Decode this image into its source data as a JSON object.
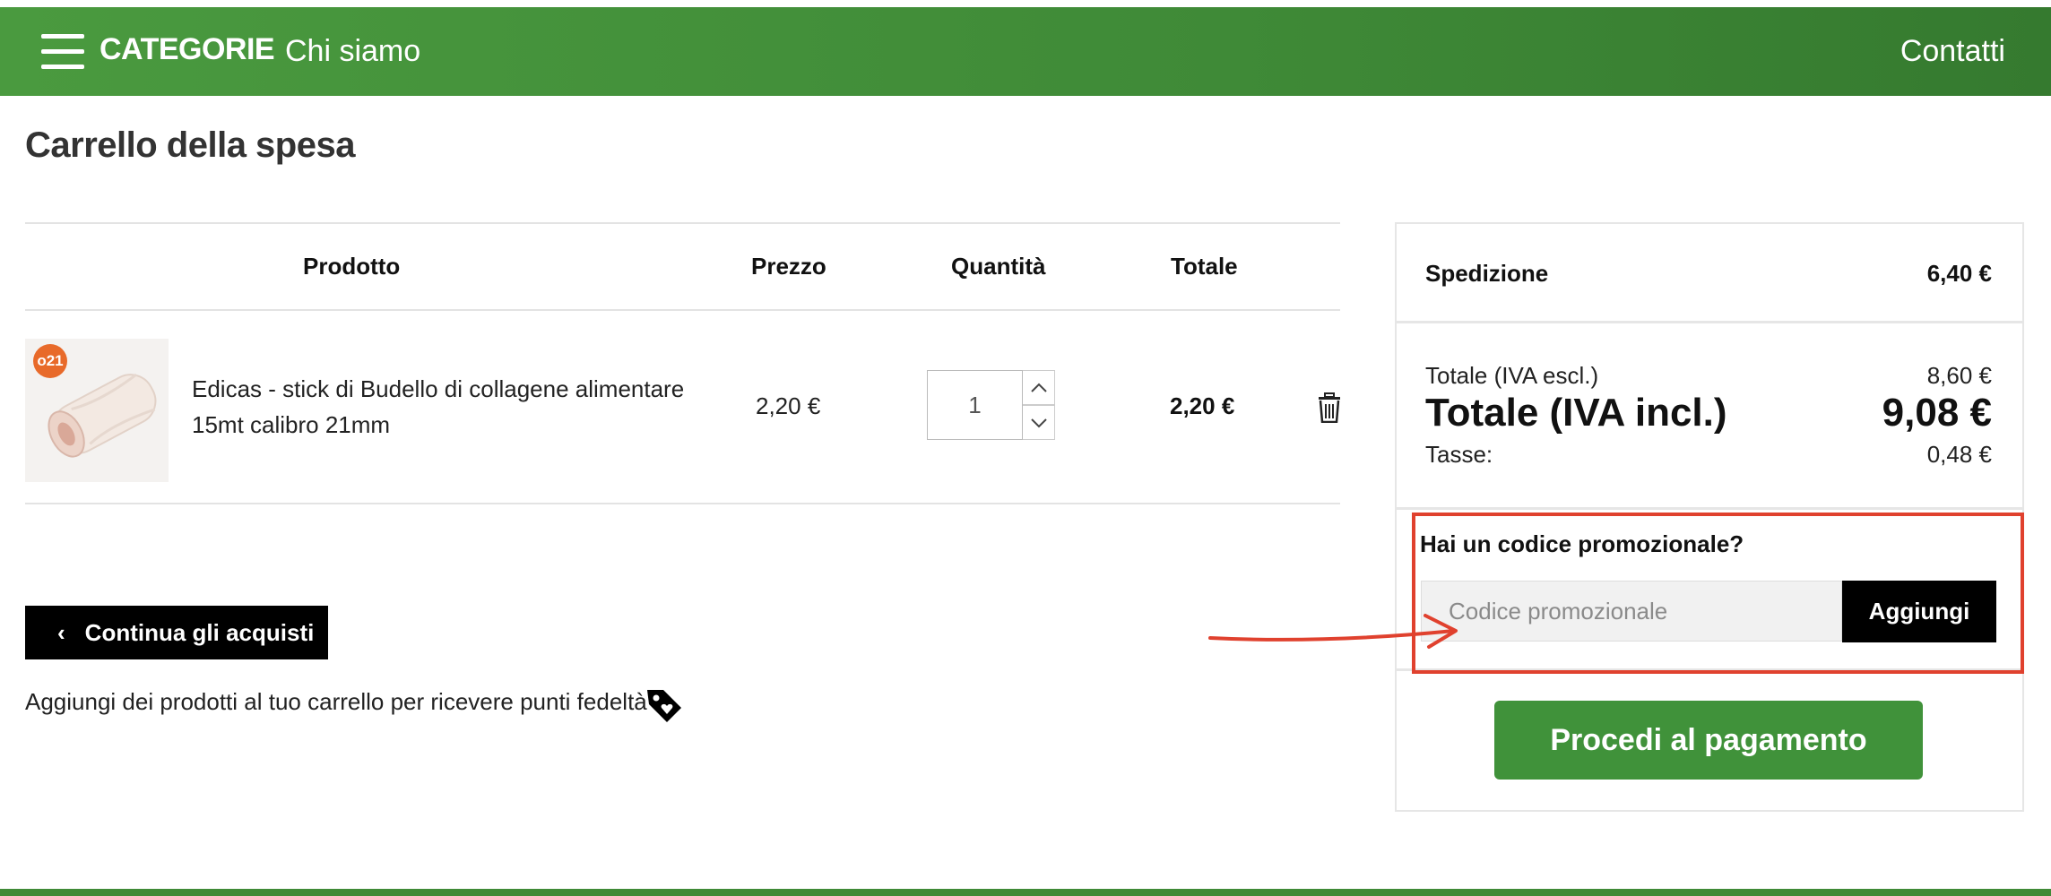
{
  "nav": {
    "menu_label": "CATEGORIE",
    "about_label": "Chi siamo",
    "contact_label": "Contatti",
    "bg_color": "#3f8a37"
  },
  "page": {
    "title": "Carrello della spesa"
  },
  "cart": {
    "columns": {
      "product": "Prodotto",
      "price": "Prezzo",
      "quantity": "Quantità",
      "total": "Totale"
    },
    "items": [
      {
        "badge": "o21",
        "name": "Edicas - stick di Budello di collagene alimentare 15mt calibro 21mm",
        "price": "2,20 €",
        "quantity": "1",
        "total": "2,20 €"
      }
    ],
    "continue_label": "Continua gli acquisti",
    "loyalty_text": "Aggiungi dei prodotti al tuo carrello per ricevere punti fedeltà ."
  },
  "summary": {
    "shipping_label": "Spedizione",
    "shipping_value": "6,40 €",
    "total_excl_label": "Totale (IVA escl.)",
    "total_excl_value": "8,60 €",
    "total_incl_label": "Totale (IVA incl.)",
    "total_incl_value": "9,08 €",
    "tax_label": "Tasse:",
    "tax_value": "0,48 €",
    "promo_title": "Hai un codice promozionale?",
    "promo_placeholder": "Codice promozionale",
    "promo_button": "Aggiungi",
    "checkout_button": "Procedi al pagamento",
    "highlight_color": "#e0412e",
    "accent_color": "#40923a"
  }
}
